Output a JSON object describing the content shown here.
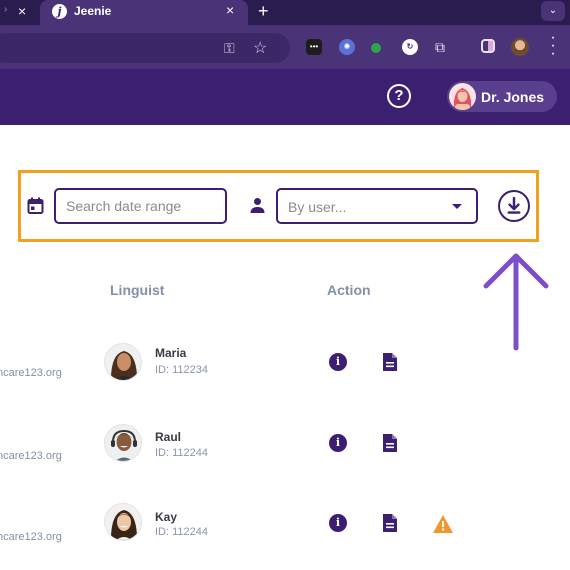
{
  "browser": {
    "prev_tab_close": "×",
    "active_tab": {
      "favicon": "j",
      "title": "Jeenie",
      "close": "×"
    },
    "new_tab": "+",
    "tab_menu": "⌄",
    "toolbar_icons": [
      "key-icon",
      "star-icon",
      "extension-icon",
      "extension-icon",
      "extension-icon",
      "extension-icon",
      "puzzle-icon",
      "sidepanel-icon",
      "profile-icon",
      "kebab-icon"
    ],
    "ext1_text": "•••",
    "ext4_text": "↻"
  },
  "header": {
    "help_label": "?",
    "user_name": "Dr. Jones"
  },
  "filters": {
    "date_placeholder": "Search date range",
    "user_placeholder": "By user...",
    "highlight_color": "#f0a21c"
  },
  "table": {
    "columns": [
      "Linguist",
      "Action"
    ],
    "rows": [
      {
        "email": "ncare123.org",
        "name": "Maria",
        "id": "ID: 112234",
        "actions": [
          "info-icon",
          "document-icon"
        ]
      },
      {
        "email": "ncare123.org",
        "name": "Raul",
        "id": "ID: 112244",
        "actions": [
          "info-icon",
          "document-icon"
        ]
      },
      {
        "email": "ncare123.org",
        "name": "Kay",
        "id": "ID: 112244",
        "actions": [
          "info-icon",
          "document-icon",
          "warning-icon"
        ]
      }
    ],
    "info_glyph": "i"
  },
  "colors": {
    "brand": "#3d1f72",
    "highlight": "#f0a21c",
    "arrow": "#7b4fc9",
    "warning": "#f0962a"
  }
}
